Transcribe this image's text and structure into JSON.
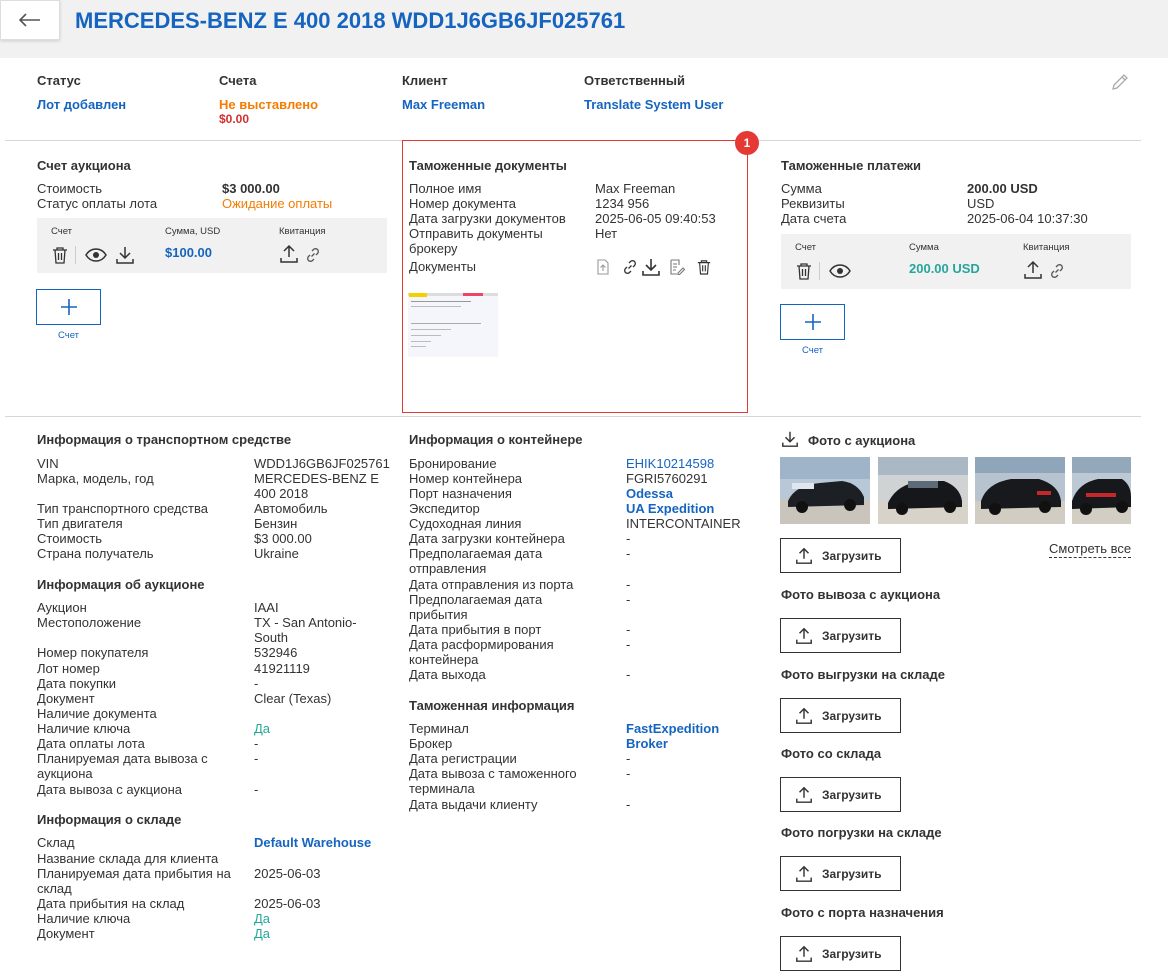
{
  "header": {
    "title": "MERCEDES-BENZ E 400 2018 WDD1J6GB6JF025761"
  },
  "summary": {
    "status_label": "Статус",
    "status_value": "Лот добавлен",
    "invoices_label": "Счета",
    "invoices_value": "Не выставлено",
    "invoices_amount": "$0.00",
    "client_label": "Клиент",
    "client_value": "Max Freeman",
    "responsible_label": "Ответственный",
    "responsible_value": "Translate System User"
  },
  "auction_invoice": {
    "title": "Счет аукциона",
    "cost_label": "Стоимость",
    "cost_value": "$3 000.00",
    "pay_status_label": "Статус оплаты лота",
    "pay_status_value": "Ожидание оплаты",
    "col_invoice": "Счет",
    "col_sum": "Сумма, USD",
    "col_receipt": "Квитанция",
    "sum_value": "$100.00",
    "add_caption": "Счет"
  },
  "customs_docs": {
    "title": "Таможенные документы",
    "rows": [
      {
        "k": "Полное имя",
        "v": "Max Freeman"
      },
      {
        "k": "Номер документа",
        "v": "1234 956"
      },
      {
        "k": "Дата загрузки документов",
        "v": "2025-06-05 09:40:53"
      },
      {
        "k": "Отправить документы брокеру",
        "v": "Нет"
      },
      {
        "k": "Документы",
        "v": ""
      }
    ],
    "badge": "1"
  },
  "customs_payments": {
    "title": "Таможенные платежи",
    "rows": [
      {
        "k": "Сумма",
        "v": "200.00 USD"
      },
      {
        "k": "Реквизиты",
        "v": "USD"
      },
      {
        "k": "Дата счета",
        "v": "2025-06-04 10:37:30"
      }
    ],
    "col_invoice": "Счет",
    "col_sum": "Сумма",
    "col_receipt": "Квитанция",
    "sum_value": "200.00 USD",
    "add_caption": "Счет"
  },
  "vehicle": {
    "title": "Информация о транспортном средстве",
    "rows": [
      {
        "k": "VIN",
        "v": "WDD1J6GB6JF025761"
      },
      {
        "k": "Марка, модель, год",
        "v": "MERCEDES-BENZ E 400 2018"
      },
      {
        "k": "Тип транспортного средства",
        "v": "Автомобиль"
      },
      {
        "k": "Тип двигателя",
        "v": "Бензин"
      },
      {
        "k": "Стоимость",
        "v": "$3 000.00"
      },
      {
        "k": "Страна получатель",
        "v": "Ukraine"
      }
    ]
  },
  "auction": {
    "title": "Информация об аукционе",
    "rows": [
      {
        "k": "Аукцион",
        "v": "IAAI"
      },
      {
        "k": "Местоположение",
        "v": "TX - San Antonio-South"
      },
      {
        "k": "Номер покупателя",
        "v": "532946"
      },
      {
        "k": "Лот номер",
        "v": "41921119"
      },
      {
        "k": "Дата покупки",
        "v": "-"
      },
      {
        "k": "Документ",
        "v": "Clear (Texas)"
      },
      {
        "k": "Наличие документа",
        "v": ""
      },
      {
        "k": "Наличие ключа",
        "v": "Да"
      },
      {
        "k": "Дата оплаты лота",
        "v": "-"
      },
      {
        "k": "Планируемая дата вывоза с аукциона",
        "v": "-"
      },
      {
        "k": "Дата вывоза с аукциона",
        "v": "-"
      }
    ]
  },
  "warehouse": {
    "title": "Информация о складе",
    "rows": [
      {
        "k": "Склад",
        "v": "Default Warehouse"
      },
      {
        "k": "Название склада для клиента",
        "v": ""
      },
      {
        "k": "Планируемая дата прибытия на склад",
        "v": "2025-06-03"
      },
      {
        "k": "Дата прибытия на склад",
        "v": "2025-06-03"
      },
      {
        "k": "Наличие ключа",
        "v": "Да"
      },
      {
        "k": "Документ",
        "v": "Да"
      }
    ]
  },
  "container": {
    "title": "Информация о контейнере",
    "rows": [
      {
        "k": "Бронирование",
        "v": "EHIK10214598"
      },
      {
        "k": "Номер контейнера",
        "v": "FGRI5760291"
      },
      {
        "k": "Порт назначения",
        "v": "Odessa"
      },
      {
        "k": "Экспедитор",
        "v": "UA Expedition"
      },
      {
        "k": "Судоходная линия",
        "v": "INTERCONTAINER"
      },
      {
        "k": "Дата загрузки контейнера",
        "v": "-"
      },
      {
        "k": "Предполагаемая дата отправления",
        "v": "-"
      },
      {
        "k": "Дата отправления из порта",
        "v": "-"
      },
      {
        "k": "Предполагаемая дата прибытия",
        "v": "-"
      },
      {
        "k": "Дата прибытия в порт",
        "v": "-"
      },
      {
        "k": "Дата расформирования контейнера",
        "v": "-"
      },
      {
        "k": "Дата выхода",
        "v": "-"
      }
    ]
  },
  "customs_info": {
    "title": "Таможенная информация",
    "rows": [
      {
        "k": "Терминал",
        "v": "FastExpedition"
      },
      {
        "k": "Брокер",
        "v": "Broker"
      },
      {
        "k": "Дата регистрации",
        "v": "-"
      },
      {
        "k": "Дата вывоза с таможенного терминала",
        "v": "-"
      },
      {
        "k": "Дата выдачи клиенту",
        "v": "-"
      }
    ]
  },
  "photos": {
    "auction_title": "Фото с аукциона",
    "view_all": "Смотреть все",
    "upload_label": "Загрузить",
    "sections": [
      "Фото вывоза с аукциона",
      "Фото выгрузки на складе",
      "Фото со склада",
      "Фото погрузки на складе",
      "Фото с порта назначения"
    ]
  }
}
